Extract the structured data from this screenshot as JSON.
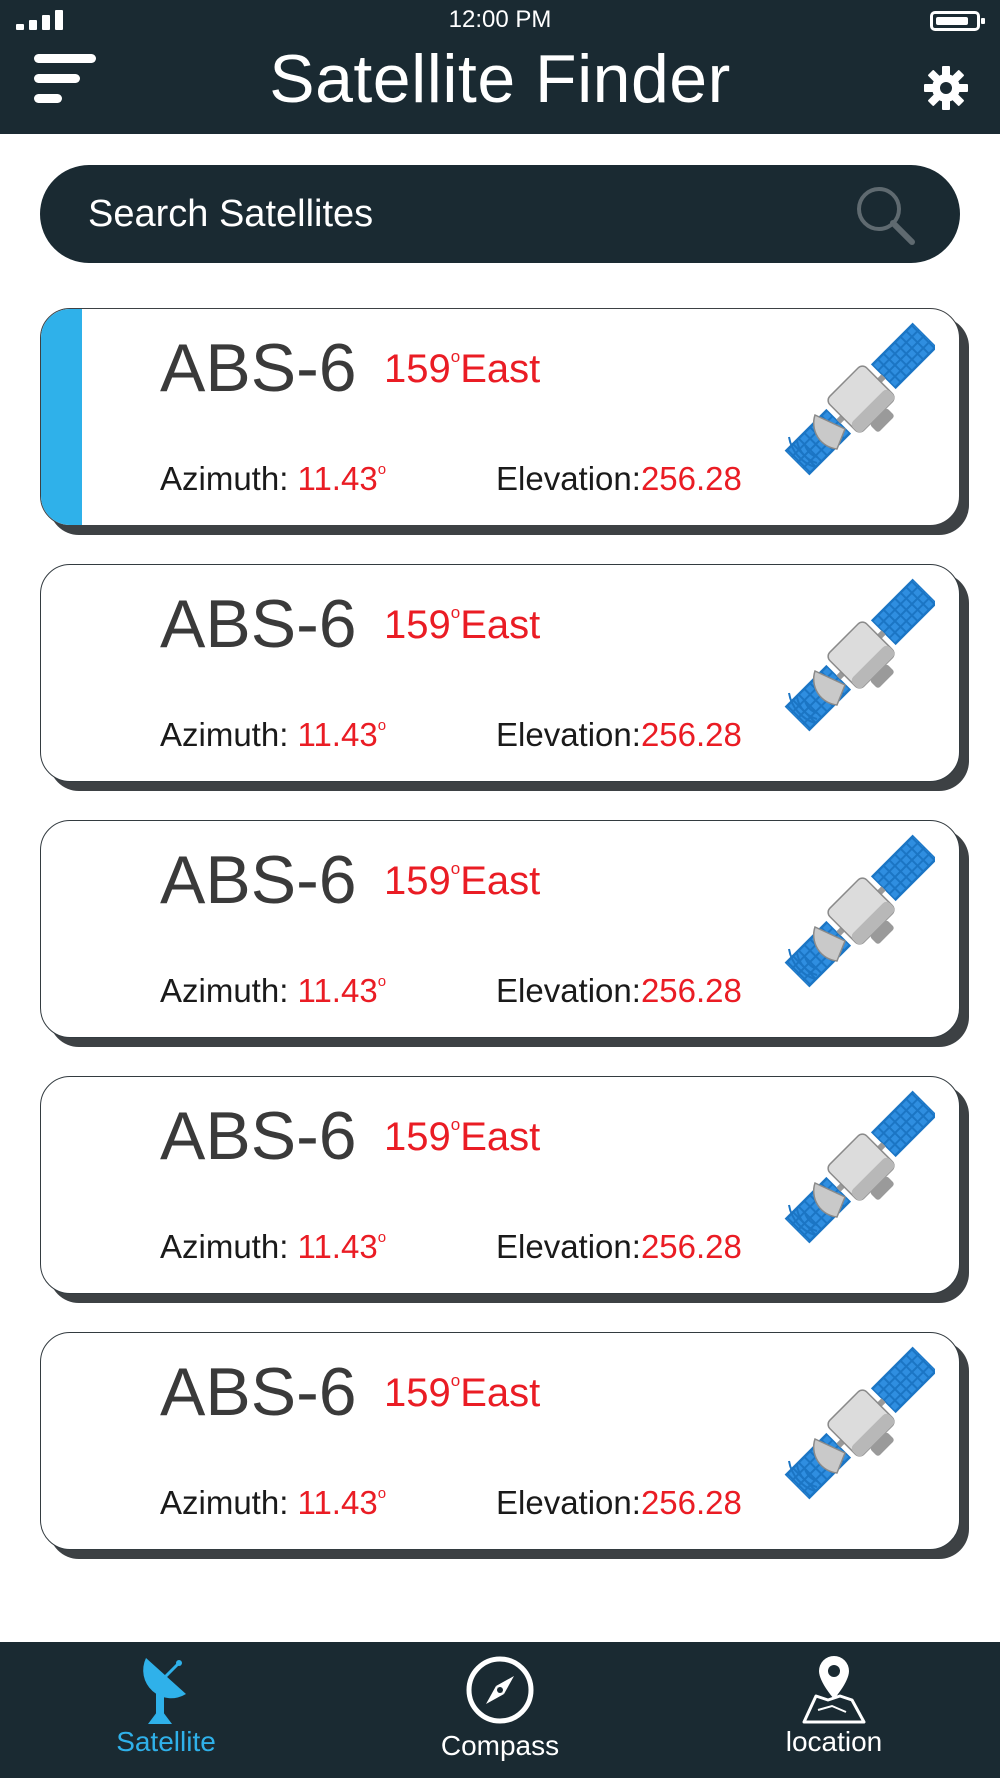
{
  "status_bar": {
    "time": "12:00 PM",
    "battery_level": 0.85
  },
  "header": {
    "title": "Satellite Finder"
  },
  "search": {
    "placeholder": "Search Satellites"
  },
  "satellites": [
    {
      "name": "ABS-6",
      "longitude": "159",
      "direction": "East",
      "azimuth_label": "Azimuth:",
      "azimuth": "11.43",
      "elevation_label": "Elevation:",
      "elevation": "256.28",
      "selected": true
    },
    {
      "name": "ABS-6",
      "longitude": "159",
      "direction": "East",
      "azimuth_label": "Azimuth:",
      "azimuth": "11.43",
      "elevation_label": "Elevation:",
      "elevation": "256.28",
      "selected": false
    },
    {
      "name": "ABS-6",
      "longitude": "159",
      "direction": "East",
      "azimuth_label": "Azimuth:",
      "azimuth": "11.43",
      "elevation_label": "Elevation:",
      "elevation": "256.28",
      "selected": false
    },
    {
      "name": "ABS-6",
      "longitude": "159",
      "direction": "East",
      "azimuth_label": "Azimuth:",
      "azimuth": "11.43",
      "elevation_label": "Elevation:",
      "elevation": "256.28",
      "selected": false
    },
    {
      "name": "ABS-6",
      "longitude": "159",
      "direction": "East",
      "azimuth_label": "Azimuth:",
      "azimuth": "11.43",
      "elevation_label": "Elevation:",
      "elevation": "256.28",
      "selected": false
    }
  ],
  "bottom_nav": {
    "items": [
      {
        "label": "Satellite",
        "icon": "satellite-dish-icon",
        "active": true
      },
      {
        "label": "Compass",
        "icon": "compass-icon",
        "active": false
      },
      {
        "label": "location",
        "icon": "map-pin-icon",
        "active": false
      }
    ]
  },
  "colors": {
    "dark_bar": "#1a2a32",
    "accent": "#2fb1ea",
    "highlight_red": "#ea1c24",
    "text_dark": "#3a3a3a"
  }
}
